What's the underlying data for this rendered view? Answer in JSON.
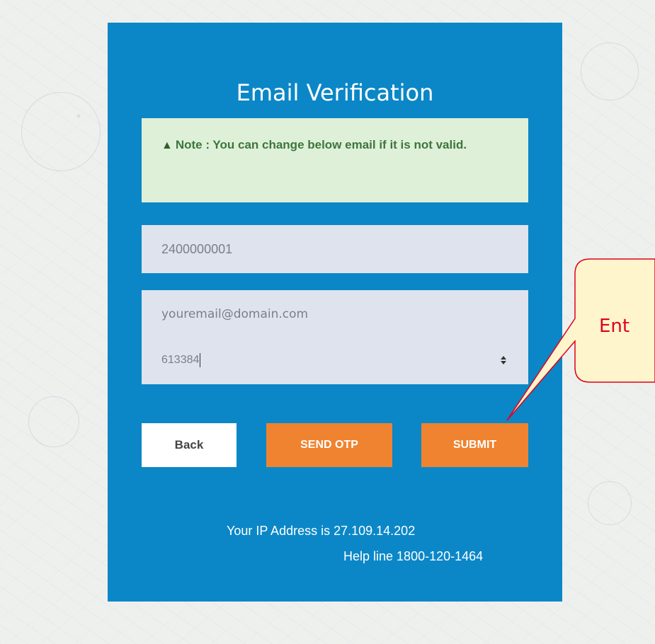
{
  "form": {
    "title": "Email Verification",
    "note_icon": "warning-triangle-icon",
    "note_text": "Note : You can change below email if it is not valid.",
    "user_id_value": "2400000001",
    "email_placeholder": "youremail@domain.com",
    "otp_value": "613384",
    "back_label": "Back",
    "send_otp_label": "SEND OTP",
    "submit_label": "SUBMIT",
    "ip_text": "Your IP Address is 27.109.14.202",
    "helpline_text": "Help line 1800-120-1464"
  },
  "callout": {
    "text": "Ent"
  },
  "colors": {
    "card_background": "#0b87c7",
    "note_background": "#dff0d8",
    "note_text": "#3c763d",
    "field_background": "#dfe3ee",
    "accent_button": "#f0832f",
    "callout_fill": "#fff5cc",
    "callout_border": "#e0001b"
  }
}
